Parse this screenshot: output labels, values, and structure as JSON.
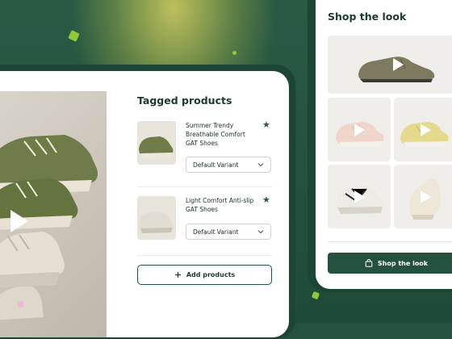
{
  "colors": {
    "brand_green": "#25513f",
    "accent_lime": "#8fc93a",
    "accent_pink": "#f2b7d8",
    "background": "#24513f"
  },
  "tagged": {
    "title": "Tagged products",
    "products": [
      {
        "name": "Summer Trendy Breathable Comfort GAT Shoes",
        "variant": "Default Variant"
      },
      {
        "name": "Light Comfort Anti-slip GAT Shoes",
        "variant": "Default Variant"
      }
    ],
    "add_label": "Add products"
  },
  "shop": {
    "title": "Shop the look",
    "button_label": "Shop the look"
  },
  "icons": {
    "play": "play-icon",
    "star": "star-icon",
    "chevron": "chevron-down-icon",
    "plus": "plus-icon",
    "bag": "shopping-bag-icon"
  }
}
